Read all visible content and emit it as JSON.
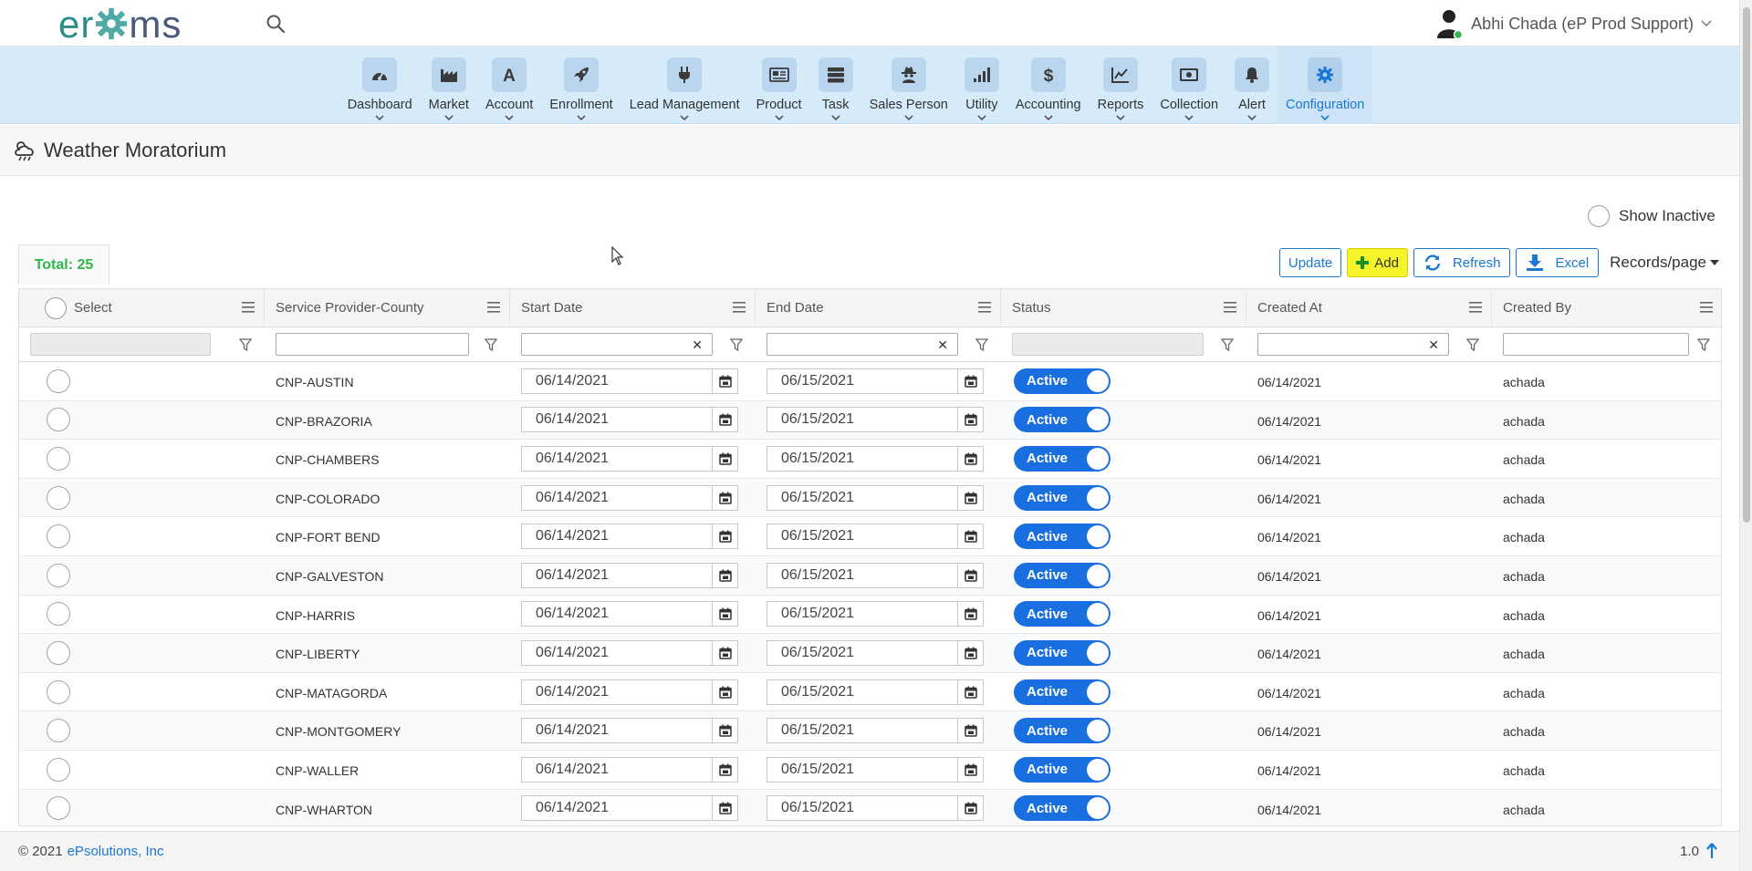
{
  "app": {
    "logo_a": "er",
    "logo_b": "ms",
    "user_name": "Abhi Chada (eP Prod Support)"
  },
  "nav": [
    {
      "label": "Dashboard",
      "icon": "gauge-icon"
    },
    {
      "label": "Market",
      "icon": "factory-icon"
    },
    {
      "label": "Account",
      "icon": "letter-a-icon"
    },
    {
      "label": "Enrollment",
      "icon": "rocket-icon"
    },
    {
      "label": "Lead Management",
      "icon": "plug-icon"
    },
    {
      "label": "Product",
      "icon": "newspaper-icon"
    },
    {
      "label": "Task",
      "icon": "server-icon"
    },
    {
      "label": "Sales Person",
      "icon": "user-secret-icon"
    },
    {
      "label": "Utility",
      "icon": "signal-bars-icon"
    },
    {
      "label": "Accounting",
      "icon": "dollar-icon"
    },
    {
      "label": "Reports",
      "icon": "line-chart-icon"
    },
    {
      "label": "Collection",
      "icon": "money-bill-icon"
    },
    {
      "label": "Alert",
      "icon": "bell-icon"
    },
    {
      "label": "Configuration",
      "icon": "gear-icon",
      "active": true
    }
  ],
  "page": {
    "title": "Weather Moratorium",
    "show_inactive_label": "Show Inactive",
    "total_label": "Total: 25"
  },
  "toolbar": {
    "update_label": "Update",
    "add_label": "Add",
    "refresh_label": "Refresh",
    "excel_label": "Excel",
    "records_label": "Records/page"
  },
  "grid": {
    "columns": [
      "Select",
      "Service Provider-County",
      "Start Date",
      "End Date",
      "Status",
      "Created At",
      "Created By"
    ],
    "rows": [
      {
        "provider": "CNP-AUSTIN",
        "start": "06/14/2021",
        "end": "06/15/2021",
        "status": "Active",
        "created_at": "06/14/2021",
        "created_by": "achada"
      },
      {
        "provider": "CNP-BRAZORIA",
        "start": "06/14/2021",
        "end": "06/15/2021",
        "status": "Active",
        "created_at": "06/14/2021",
        "created_by": "achada"
      },
      {
        "provider": "CNP-CHAMBERS",
        "start": "06/14/2021",
        "end": "06/15/2021",
        "status": "Active",
        "created_at": "06/14/2021",
        "created_by": "achada"
      },
      {
        "provider": "CNP-COLORADO",
        "start": "06/14/2021",
        "end": "06/15/2021",
        "status": "Active",
        "created_at": "06/14/2021",
        "created_by": "achada"
      },
      {
        "provider": "CNP-FORT BEND",
        "start": "06/14/2021",
        "end": "06/15/2021",
        "status": "Active",
        "created_at": "06/14/2021",
        "created_by": "achada"
      },
      {
        "provider": "CNP-GALVESTON",
        "start": "06/14/2021",
        "end": "06/15/2021",
        "status": "Active",
        "created_at": "06/14/2021",
        "created_by": "achada"
      },
      {
        "provider": "CNP-HARRIS",
        "start": "06/14/2021",
        "end": "06/15/2021",
        "status": "Active",
        "created_at": "06/14/2021",
        "created_by": "achada"
      },
      {
        "provider": "CNP-LIBERTY",
        "start": "06/14/2021",
        "end": "06/15/2021",
        "status": "Active",
        "created_at": "06/14/2021",
        "created_by": "achada"
      },
      {
        "provider": "CNP-MATAGORDA",
        "start": "06/14/2021",
        "end": "06/15/2021",
        "status": "Active",
        "created_at": "06/14/2021",
        "created_by": "achada"
      },
      {
        "provider": "CNP-MONTGOMERY",
        "start": "06/14/2021",
        "end": "06/15/2021",
        "status": "Active",
        "created_at": "06/14/2021",
        "created_by": "achada"
      },
      {
        "provider": "CNP-WALLER",
        "start": "06/14/2021",
        "end": "06/15/2021",
        "status": "Active",
        "created_at": "06/14/2021",
        "created_by": "achada"
      },
      {
        "provider": "CNP-WHARTON",
        "start": "06/14/2021",
        "end": "06/15/2021",
        "status": "Active",
        "created_at": "06/14/2021",
        "created_by": "achada"
      }
    ]
  },
  "footer": {
    "copyright": "© 2021",
    "company": "ePsolutions, Inc",
    "version": "1.0"
  },
  "colors": {
    "accent": "#1a77d2",
    "nav_bg": "#d6ebfa",
    "add_button": "#f7f32a",
    "total_text": "#2db84b",
    "toggle_on": "#1a6fe0"
  }
}
